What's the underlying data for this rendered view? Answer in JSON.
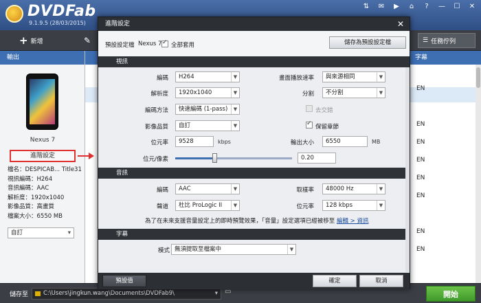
{
  "app": {
    "logo": "DVDFab",
    "version": "9.1.9.5 (28/03/2015)",
    "window_controls": [
      "⇅",
      "✉",
      "▶",
      "⌂",
      "?",
      "—",
      "☐",
      "✕"
    ]
  },
  "toolbar": {
    "add_label": "新增",
    "tasks_label": "任務佇列"
  },
  "left_panel": {
    "header": "輸出",
    "device_name": "Nexus 7",
    "advanced_button": "進階設定",
    "info": [
      "檔名：DESPICAB... Title31",
      "視訊編碼：H264",
      "音訊編碼：AAC",
      "解析度：1920x1040",
      "影像品質：高畫質",
      "檔案大小：6550 MB"
    ],
    "profile_select": "自訂"
  },
  "right_list": {
    "subtitle_header": "字幕",
    "rows": [
      "EN",
      "EN",
      "EN",
      "EN",
      "EN",
      "EN",
      "EN",
      "EN"
    ]
  },
  "bottom": {
    "save_to_label": "儲存至",
    "save_path": "C:\\Users\\jingkun.wang\\Documents\\DVDFab9\\",
    "start_label": "開始"
  },
  "dialog": {
    "title": "進階設定",
    "preset_label": "預設設定檔",
    "preset_name": "Nexus 7",
    "apply_all_label": "全部套用",
    "save_preset_button": "儲存為預設設定檔",
    "video": {
      "section_label": "視訊",
      "codec_label": "編碼",
      "codec": "H264",
      "fps_label": "畫面播放速率",
      "fps": "與來源相同",
      "resolution_label": "解析度",
      "resolution": "1920x1040",
      "split_label": "分割",
      "split": "不分割",
      "encode_method_label": "編碼方法",
      "encode_method": "快速編碼 (1-pass)",
      "deinterlace_label": "去交錯",
      "quality_label": "影像品質",
      "quality": "自訂",
      "keep_chapters_label": "保留章節",
      "bitrate_label": "位元率",
      "bitrate": "9528",
      "bitrate_unit": "kbps",
      "output_size_label": "輸出大小",
      "output_size": "6550",
      "output_size_unit": "MB",
      "bits_per_pixel_label": "位元/像素",
      "bits_per_pixel": "0.20"
    },
    "audio": {
      "section_label": "音訊",
      "codec_label": "編碼",
      "codec": "AAC",
      "sample_rate_label": "取樣率",
      "sample_rate": "48000 Hz",
      "channels_label": "聲道",
      "channels": "杜比 ProLogic II",
      "bitrate_label": "位元率",
      "bitrate": "128 kbps",
      "note": "為了在未來支援音量設定上的即時預覽效果，「音量」設定選項已經被移至",
      "note_link": "編輯 > 資訊"
    },
    "subtitle": {
      "section_label": "字幕",
      "mode_label": "模式",
      "mode": "無須提取至檔案中"
    },
    "footer": {
      "preset_button": "預設值",
      "ok_button": "確定",
      "cancel_button": "取消"
    }
  }
}
